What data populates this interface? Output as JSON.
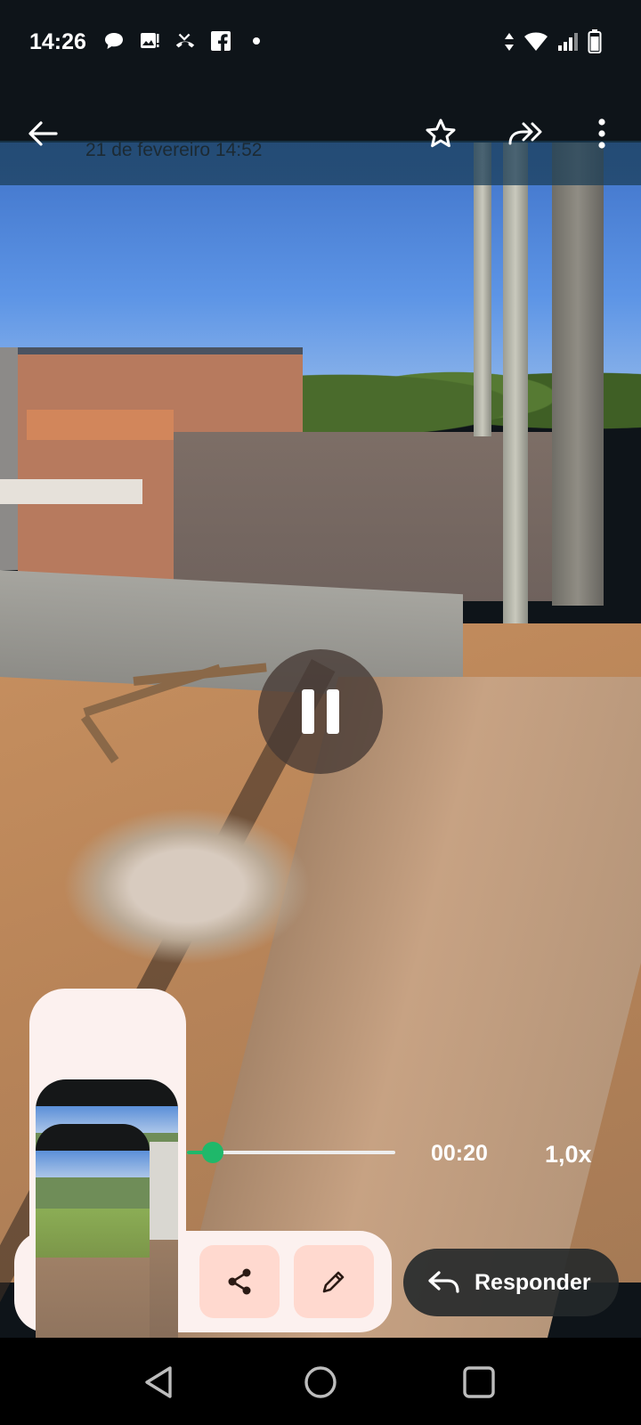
{
  "status_bar": {
    "time": "14:26",
    "notification_icons": [
      "chat-bubble-icon",
      "gallery-alert-icon",
      "missed-call-icon",
      "facebook-icon",
      "dot-icon"
    ],
    "system_icons": [
      "data-arrows-icon",
      "wifi-icon",
      "signal-icon",
      "battery-icon"
    ]
  },
  "header": {
    "sender": "",
    "date": "21 de fevereiro 14:52",
    "actions": [
      "back-arrow-icon",
      "star-icon",
      "forward-icon",
      "more-vert-icon"
    ]
  },
  "player": {
    "state": "playing",
    "progress_fraction": 0.08,
    "elapsed": "00:20",
    "speed": "1,0x",
    "accent_color": "#1fb86a"
  },
  "actions": {
    "share_icon": "share-icon",
    "edit_icon": "edit-pencil-icon"
  },
  "reply": {
    "label": "Responder"
  },
  "colors": {
    "bar_background": "#0e1419",
    "pill_background": "#fcf1ef",
    "action_button": "#ffd9cf"
  }
}
